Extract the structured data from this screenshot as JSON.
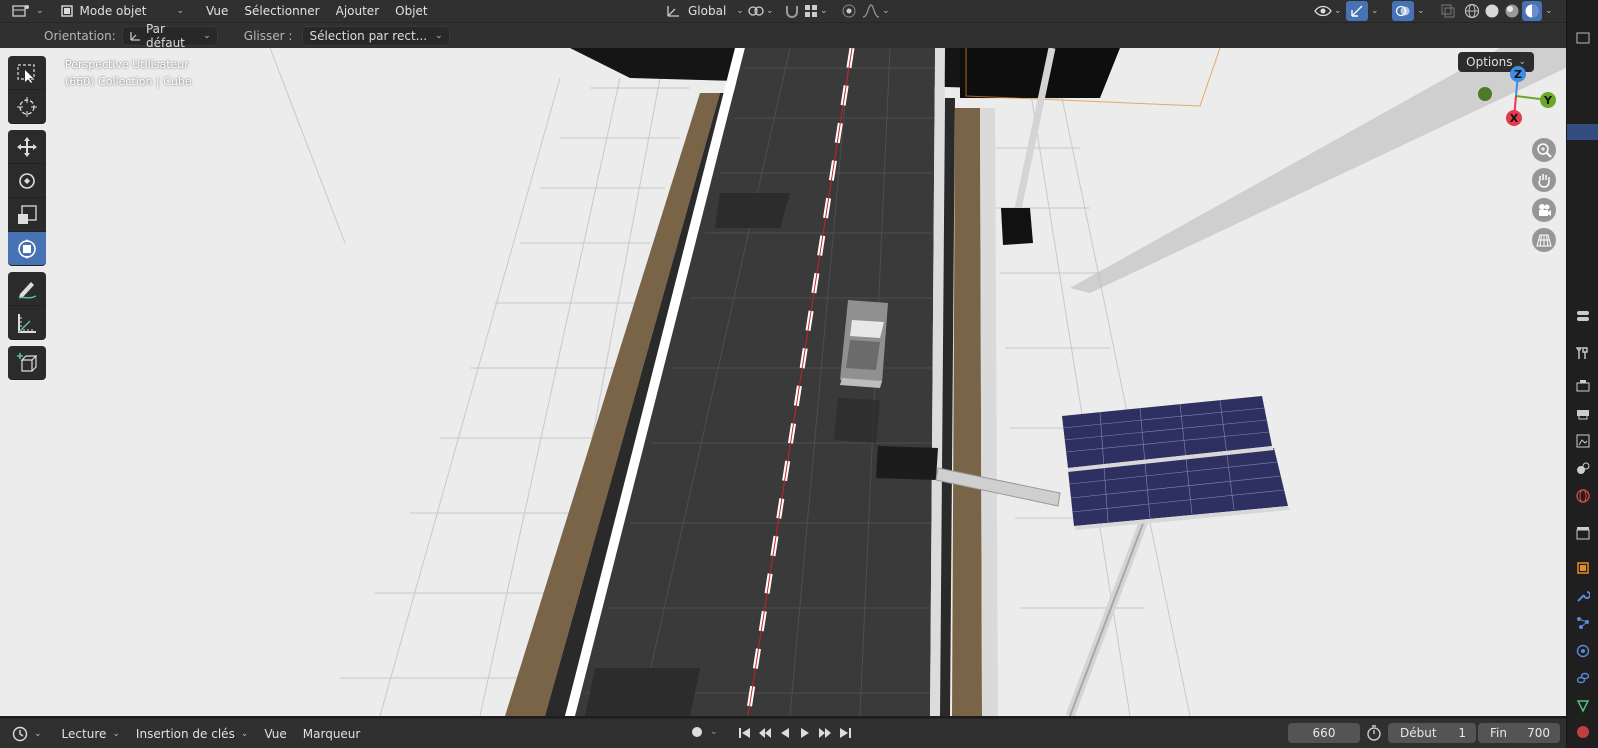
{
  "header": {
    "mode_label": "Mode objet",
    "menus": [
      "Vue",
      "Sélectionner",
      "Ajouter",
      "Objet"
    ],
    "transform_orientation": "Global"
  },
  "toolbar": {
    "orientation_label": "Orientation:",
    "orientation_value": "Par défaut",
    "drag_label": "Glisser :",
    "drag_value": "Sélection par rect..."
  },
  "viewport": {
    "view_name": "Perspective Utilisateur",
    "collection_info": "(660) Collection | Cube",
    "options_label": "Options",
    "gizmo_axes": [
      "Z",
      "Y",
      "X"
    ]
  },
  "tools": [
    {
      "icon": "select-box-icon"
    },
    {
      "icon": "cursor-icon"
    },
    {
      "icon": "move-icon"
    },
    {
      "icon": "rotate-icon"
    },
    {
      "icon": "scale-icon"
    },
    {
      "icon": "transform-icon",
      "active": true
    },
    {
      "icon": "annotate-icon"
    },
    {
      "icon": "measure-icon"
    },
    {
      "icon": "add-cube-icon"
    }
  ],
  "timeline": {
    "playback_label": "Lecture",
    "keying_label": "Insertion de clés",
    "view_label": "Vue",
    "marker_label": "Marqueur",
    "current_frame": "660",
    "start_label": "Début",
    "start_value": "1",
    "end_label": "Fin",
    "end_value": "700"
  },
  "colors": {
    "accent": "#4772b3",
    "header_bg": "#303030",
    "axis_x": "#e23b4e",
    "axis_y": "#6ba72a",
    "axis_z": "#3b8ee2"
  }
}
